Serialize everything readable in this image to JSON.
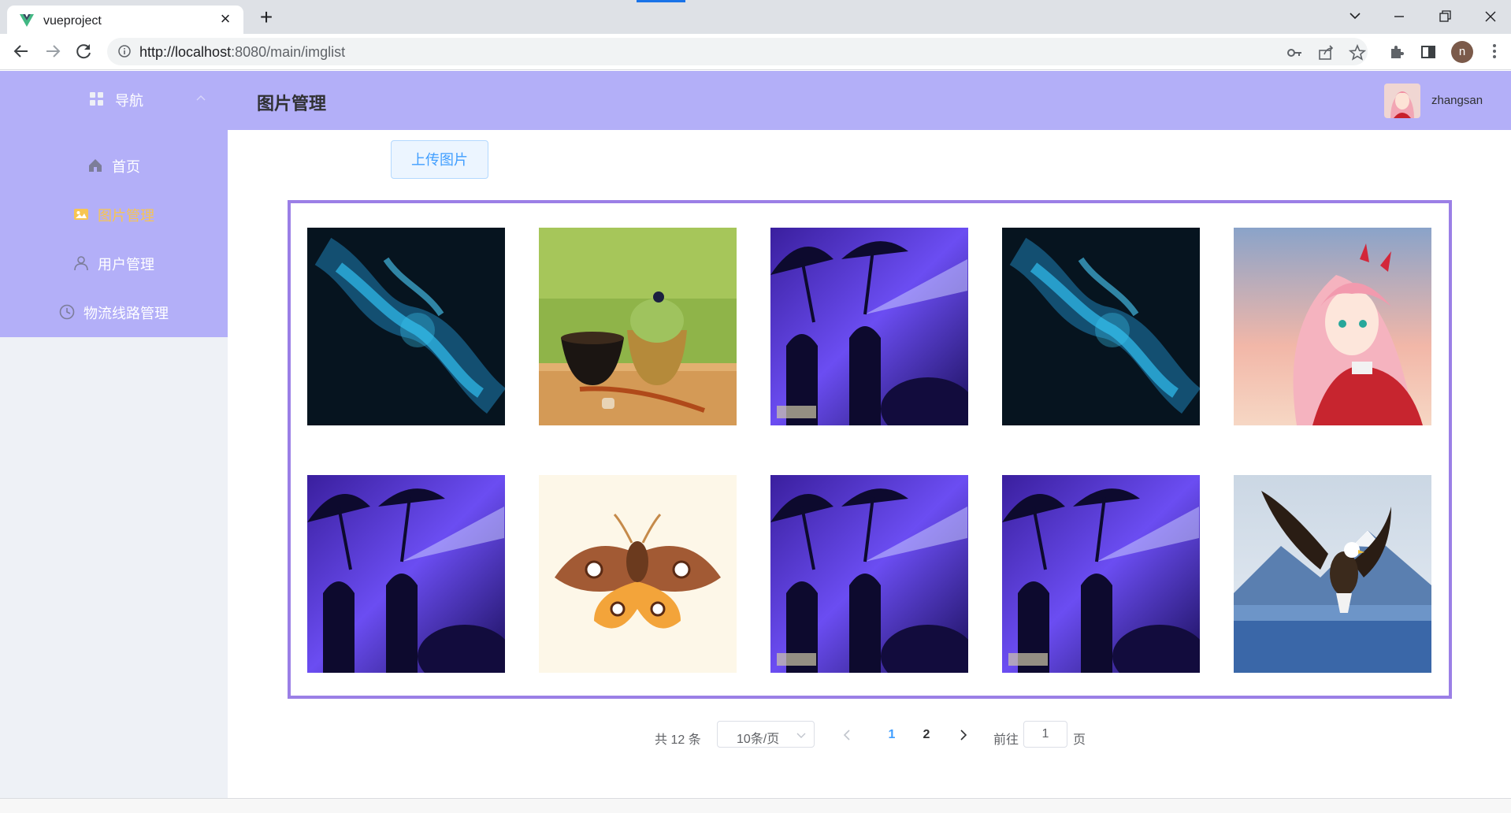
{
  "browser": {
    "tab_title": "vueproject",
    "url_host": "http://localhost",
    "url_rest": ":8080/main/imglist",
    "tab_close": "×",
    "new_tab": "+",
    "profile_initial": "n"
  },
  "sidebar": {
    "header_label": "导航",
    "items": [
      {
        "label": "首页",
        "icon": "home-icon",
        "active": false
      },
      {
        "label": "图片管理",
        "icon": "picture-icon",
        "active": true
      },
      {
        "label": "用户管理",
        "icon": "user-icon",
        "active": false
      },
      {
        "label": "物流线路管理",
        "icon": "clock-icon",
        "active": false
      }
    ]
  },
  "header": {
    "title": "图片管理",
    "username": "zhangsan"
  },
  "main": {
    "upload_label": "上传图片",
    "images": [
      {
        "subject": "blue-nebula"
      },
      {
        "subject": "matcha-ice-cream"
      },
      {
        "subject": "umbrella-silhouettes"
      },
      {
        "subject": "blue-nebula"
      },
      {
        "subject": "anime-girl"
      },
      {
        "subject": "umbrella-silhouettes"
      },
      {
        "subject": "moth"
      },
      {
        "subject": "umbrella-silhouettes"
      },
      {
        "subject": "umbrella-silhouettes"
      },
      {
        "subject": "eagle"
      }
    ]
  },
  "pagination": {
    "total_text": "共 12 条",
    "page_size": "10条/页",
    "pages": [
      "1",
      "2"
    ],
    "current_page": "1",
    "goto_label": "前往",
    "goto_value": "1",
    "goto_unit": "页"
  },
  "colors": {
    "sidebar_bg": "#b3aff8",
    "active_menu": "#f7c552",
    "gallery_border": "#9b7fe6",
    "primary": "#409eff"
  }
}
